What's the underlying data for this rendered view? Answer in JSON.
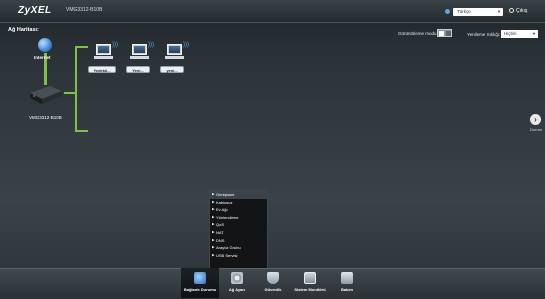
{
  "header": {
    "logo": "ZyXEL",
    "model": "VMG3312-B10B",
    "language": "Türkçe",
    "exit_label": "Çıkış"
  },
  "map": {
    "title": "Ağ Haritası:",
    "view_mode_label": "Görüntüleme modu :",
    "refresh_label": "Yenileme Sıklığı:",
    "refresh_value": "Hiçbiri",
    "internet_label": "Internet",
    "router_label": "VMG3312-B10B",
    "devices": [
      "Yedekli...",
      "Yeni...",
      "yeni..."
    ]
  },
  "side_nav": {
    "label": "Durum"
  },
  "menu": {
    "items": [
      "Genişbant",
      "Kablosuz",
      "Ev Ağı",
      "Yönlendirme",
      "QoS",
      "NAT",
      "DNS",
      "Arayüz Grubu",
      "USB Servisi"
    ],
    "selected_index": 0
  },
  "bottom_nav": {
    "items": [
      {
        "label": "Bağlantı Durumu",
        "icon": "network-setting-icon",
        "active": true
      },
      {
        "label": "Ağ Ayarı",
        "icon": "gear-icon",
        "active": false
      },
      {
        "label": "Güvenlik",
        "icon": "shield-icon",
        "active": false
      },
      {
        "label": "Sistem Monitörü",
        "icon": "monitor-icon",
        "active": false
      },
      {
        "label": "Bakım",
        "icon": "maintenance-icon",
        "active": false
      }
    ]
  }
}
